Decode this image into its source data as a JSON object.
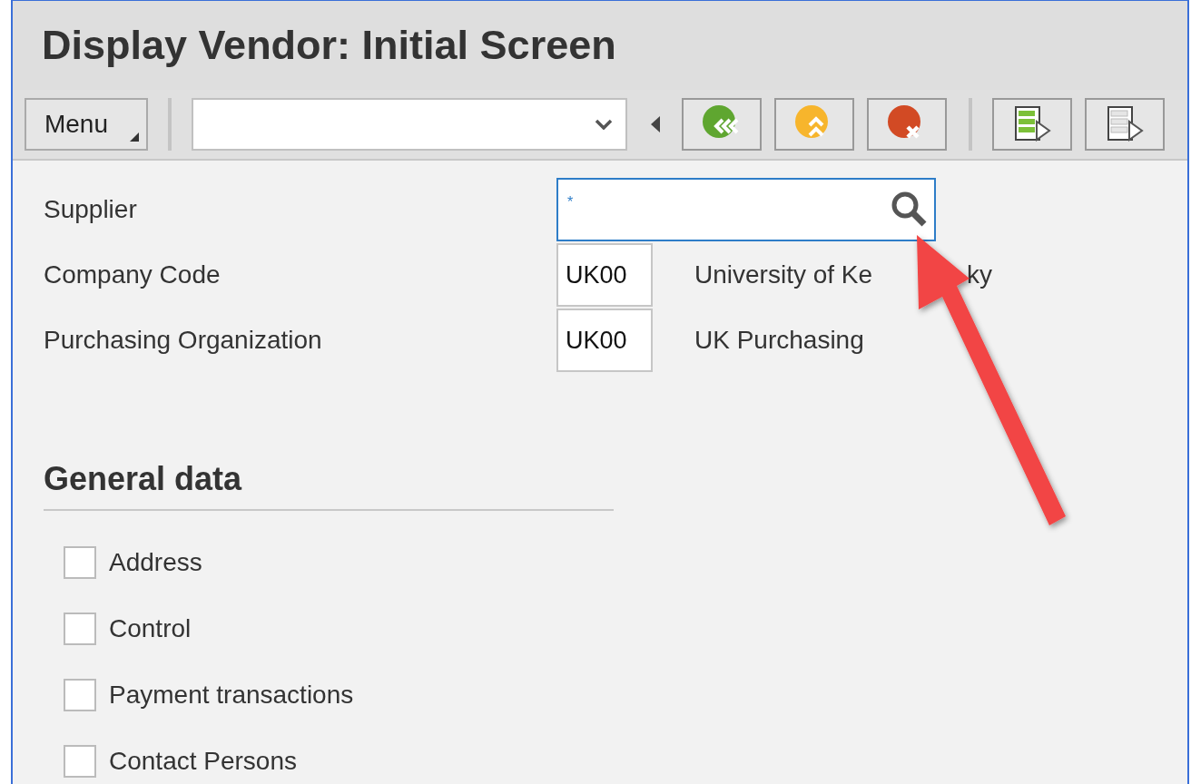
{
  "window": {
    "title": "Display Vendor:  Initial Screen"
  },
  "toolbar": {
    "menu_button": "Menu",
    "buttons": [
      {
        "kind": "back"
      },
      {
        "kind": "exit"
      },
      {
        "kind": "cancel"
      },
      {
        "kind": "select-all"
      },
      {
        "kind": "deselect-all"
      }
    ]
  },
  "fields": [
    {
      "label": "Supplier",
      "kind": "search",
      "required_mark": "*"
    },
    {
      "label": "Company Code",
      "kind": "code",
      "value": "UK00",
      "description": [
        "University of Ke",
        "ky"
      ]
    },
    {
      "label": "Purchasing Organization",
      "kind": "code",
      "value": "UK00",
      "description": [
        "UK Purchasing"
      ]
    }
  ],
  "general_data": {
    "title": "General data",
    "options": [
      {
        "label": "Address",
        "checked": false
      },
      {
        "label": "Control",
        "checked": false
      },
      {
        "label": "Payment transactions",
        "checked": false
      },
      {
        "label": "Contact Persons",
        "checked": false
      }
    ]
  }
}
